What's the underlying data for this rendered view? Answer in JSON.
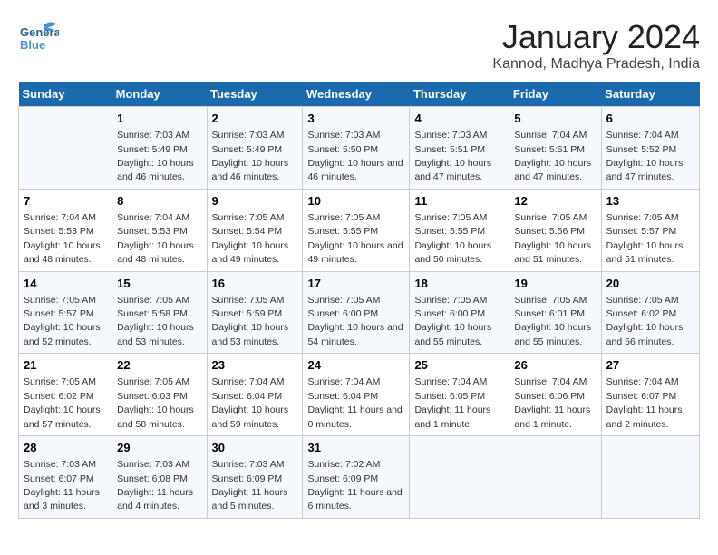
{
  "logo": {
    "line1": "General",
    "line2": "Blue"
  },
  "title": "January 2024",
  "subtitle": "Kannod, Madhya Pradesh, India",
  "days_header": [
    "Sunday",
    "Monday",
    "Tuesday",
    "Wednesday",
    "Thursday",
    "Friday",
    "Saturday"
  ],
  "weeks": [
    [
      {
        "day": "",
        "sunrise": "",
        "sunset": "",
        "daylight": ""
      },
      {
        "day": "1",
        "sunrise": "Sunrise: 7:03 AM",
        "sunset": "Sunset: 5:49 PM",
        "daylight": "Daylight: 10 hours and 46 minutes."
      },
      {
        "day": "2",
        "sunrise": "Sunrise: 7:03 AM",
        "sunset": "Sunset: 5:49 PM",
        "daylight": "Daylight: 10 hours and 46 minutes."
      },
      {
        "day": "3",
        "sunrise": "Sunrise: 7:03 AM",
        "sunset": "Sunset: 5:50 PM",
        "daylight": "Daylight: 10 hours and 46 minutes."
      },
      {
        "day": "4",
        "sunrise": "Sunrise: 7:03 AM",
        "sunset": "Sunset: 5:51 PM",
        "daylight": "Daylight: 10 hours and 47 minutes."
      },
      {
        "day": "5",
        "sunrise": "Sunrise: 7:04 AM",
        "sunset": "Sunset: 5:51 PM",
        "daylight": "Daylight: 10 hours and 47 minutes."
      },
      {
        "day": "6",
        "sunrise": "Sunrise: 7:04 AM",
        "sunset": "Sunset: 5:52 PM",
        "daylight": "Daylight: 10 hours and 47 minutes."
      }
    ],
    [
      {
        "day": "7",
        "sunrise": "Sunrise: 7:04 AM",
        "sunset": "Sunset: 5:53 PM",
        "daylight": "Daylight: 10 hours and 48 minutes."
      },
      {
        "day": "8",
        "sunrise": "Sunrise: 7:04 AM",
        "sunset": "Sunset: 5:53 PM",
        "daylight": "Daylight: 10 hours and 48 minutes."
      },
      {
        "day": "9",
        "sunrise": "Sunrise: 7:05 AM",
        "sunset": "Sunset: 5:54 PM",
        "daylight": "Daylight: 10 hours and 49 minutes."
      },
      {
        "day": "10",
        "sunrise": "Sunrise: 7:05 AM",
        "sunset": "Sunset: 5:55 PM",
        "daylight": "Daylight: 10 hours and 49 minutes."
      },
      {
        "day": "11",
        "sunrise": "Sunrise: 7:05 AM",
        "sunset": "Sunset: 5:55 PM",
        "daylight": "Daylight: 10 hours and 50 minutes."
      },
      {
        "day": "12",
        "sunrise": "Sunrise: 7:05 AM",
        "sunset": "Sunset: 5:56 PM",
        "daylight": "Daylight: 10 hours and 51 minutes."
      },
      {
        "day": "13",
        "sunrise": "Sunrise: 7:05 AM",
        "sunset": "Sunset: 5:57 PM",
        "daylight": "Daylight: 10 hours and 51 minutes."
      }
    ],
    [
      {
        "day": "14",
        "sunrise": "Sunrise: 7:05 AM",
        "sunset": "Sunset: 5:57 PM",
        "daylight": "Daylight: 10 hours and 52 minutes."
      },
      {
        "day": "15",
        "sunrise": "Sunrise: 7:05 AM",
        "sunset": "Sunset: 5:58 PM",
        "daylight": "Daylight: 10 hours and 53 minutes."
      },
      {
        "day": "16",
        "sunrise": "Sunrise: 7:05 AM",
        "sunset": "Sunset: 5:59 PM",
        "daylight": "Daylight: 10 hours and 53 minutes."
      },
      {
        "day": "17",
        "sunrise": "Sunrise: 7:05 AM",
        "sunset": "Sunset: 6:00 PM",
        "daylight": "Daylight: 10 hours and 54 minutes."
      },
      {
        "day": "18",
        "sunrise": "Sunrise: 7:05 AM",
        "sunset": "Sunset: 6:00 PM",
        "daylight": "Daylight: 10 hours and 55 minutes."
      },
      {
        "day": "19",
        "sunrise": "Sunrise: 7:05 AM",
        "sunset": "Sunset: 6:01 PM",
        "daylight": "Daylight: 10 hours and 55 minutes."
      },
      {
        "day": "20",
        "sunrise": "Sunrise: 7:05 AM",
        "sunset": "Sunset: 6:02 PM",
        "daylight": "Daylight: 10 hours and 56 minutes."
      }
    ],
    [
      {
        "day": "21",
        "sunrise": "Sunrise: 7:05 AM",
        "sunset": "Sunset: 6:02 PM",
        "daylight": "Daylight: 10 hours and 57 minutes."
      },
      {
        "day": "22",
        "sunrise": "Sunrise: 7:05 AM",
        "sunset": "Sunset: 6:03 PM",
        "daylight": "Daylight: 10 hours and 58 minutes."
      },
      {
        "day": "23",
        "sunrise": "Sunrise: 7:04 AM",
        "sunset": "Sunset: 6:04 PM",
        "daylight": "Daylight: 10 hours and 59 minutes."
      },
      {
        "day": "24",
        "sunrise": "Sunrise: 7:04 AM",
        "sunset": "Sunset: 6:04 PM",
        "daylight": "Daylight: 11 hours and 0 minutes."
      },
      {
        "day": "25",
        "sunrise": "Sunrise: 7:04 AM",
        "sunset": "Sunset: 6:05 PM",
        "daylight": "Daylight: 11 hours and 1 minute."
      },
      {
        "day": "26",
        "sunrise": "Sunrise: 7:04 AM",
        "sunset": "Sunset: 6:06 PM",
        "daylight": "Daylight: 11 hours and 1 minute."
      },
      {
        "day": "27",
        "sunrise": "Sunrise: 7:04 AM",
        "sunset": "Sunset: 6:07 PM",
        "daylight": "Daylight: 11 hours and 2 minutes."
      }
    ],
    [
      {
        "day": "28",
        "sunrise": "Sunrise: 7:03 AM",
        "sunset": "Sunset: 6:07 PM",
        "daylight": "Daylight: 11 hours and 3 minutes."
      },
      {
        "day": "29",
        "sunrise": "Sunrise: 7:03 AM",
        "sunset": "Sunset: 6:08 PM",
        "daylight": "Daylight: 11 hours and 4 minutes."
      },
      {
        "day": "30",
        "sunrise": "Sunrise: 7:03 AM",
        "sunset": "Sunset: 6:09 PM",
        "daylight": "Daylight: 11 hours and 5 minutes."
      },
      {
        "day": "31",
        "sunrise": "Sunrise: 7:02 AM",
        "sunset": "Sunset: 6:09 PM",
        "daylight": "Daylight: 11 hours and 6 minutes."
      },
      {
        "day": "",
        "sunrise": "",
        "sunset": "",
        "daylight": ""
      },
      {
        "day": "",
        "sunrise": "",
        "sunset": "",
        "daylight": ""
      },
      {
        "day": "",
        "sunrise": "",
        "sunset": "",
        "daylight": ""
      }
    ]
  ]
}
